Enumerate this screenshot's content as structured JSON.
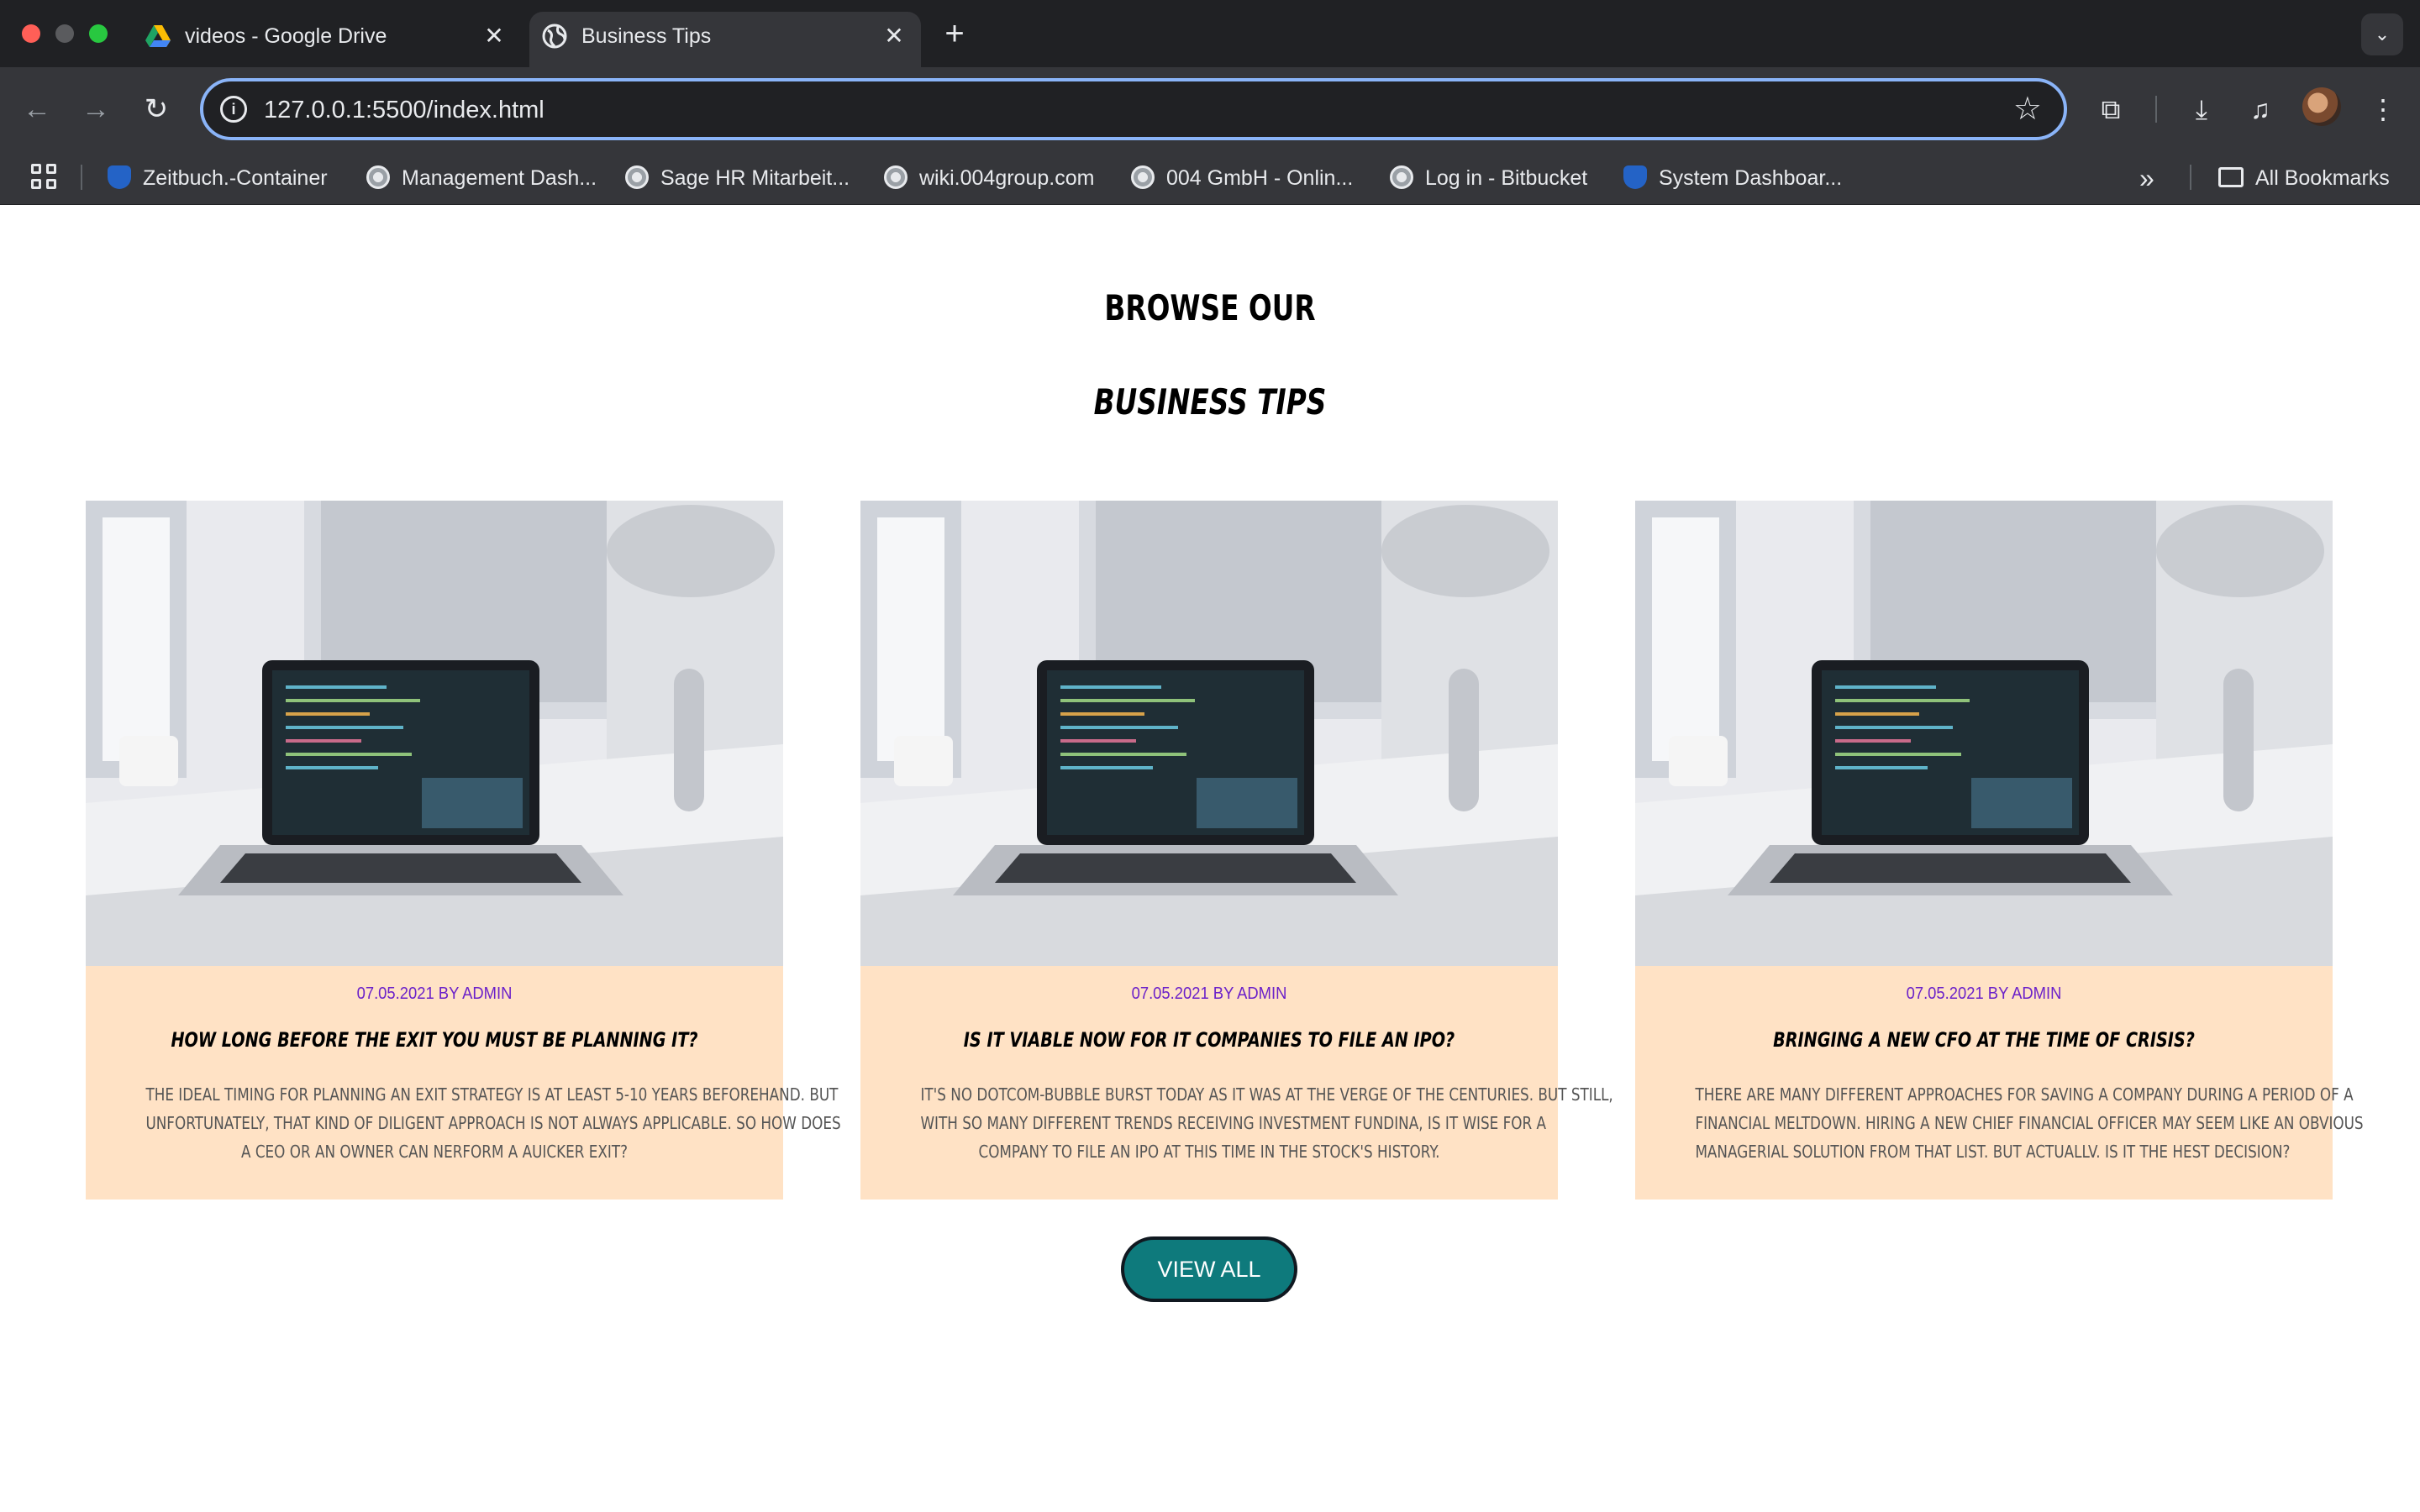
{
  "browser": {
    "tabs": [
      {
        "title": "videos - Google Drive",
        "active": false
      },
      {
        "title": "Business Tips",
        "active": true
      }
    ],
    "url": "127.0.0.1:5500/index.html",
    "bookmarks": [
      {
        "label": "Zeitbuch.-Container",
        "icon": "jira-icon"
      },
      {
        "label": "Management Dash...",
        "icon": "globe-icon"
      },
      {
        "label": "Sage HR Mitarbeit...",
        "icon": "globe-icon"
      },
      {
        "label": "wiki.004group.com",
        "icon": "globe-icon"
      },
      {
        "label": "004 GmbH - Onlin...",
        "icon": "globe-icon"
      },
      {
        "label": "Log in - Bitbucket",
        "icon": "globe-icon"
      },
      {
        "label": "System Dashboar...",
        "icon": "jira-icon"
      }
    ],
    "all_bookmarks_label": "All Bookmarks"
  },
  "page": {
    "heading_line1": "BROWSE OUR",
    "heading_line2": "BUSINESS TIPS",
    "cards": [
      {
        "meta": "07.05.2021 BY ADMIN",
        "title": "HOW LONG BEFORE THE EXIT YOU MUST BE PLANNING IT?",
        "excerpt": [
          "THE IDEAL TIMING FOR PLANNING AN EXIT STRATEGY IS AT LEAST 5-10 YEARS BEFOREHAND. BUT",
          "UNFORTUNATELY, THAT KIND OF DILIGENT APPROACH IS NOT ALWAYS APPLICABLE. SO HOW DOES",
          "A CEO OR AN OWNER CAN NERFORM A AUICKER EXIT?"
        ]
      },
      {
        "meta": "07.05.2021 BY ADMIN",
        "title": "IS IT VIABLE NOW FOR IT COMPANIES TO FILE AN IPO?",
        "excerpt": [
          "IT'S NO DOTCOM-BUBBLE BURST TODAY AS IT WAS AT THE VERGE OF THE CENTURIES. BUT STILL,",
          "WITH SO MANY DIFFERENT TRENDS RECEIVING INVESTMENT FUNDINA, IS IT WISE FOR A",
          "COMPANY TO FILE AN IPO AT THIS TIME IN THE STOCK'S HISTORY."
        ]
      },
      {
        "meta": "07.05.2021 BY ADMIN",
        "title": "BRINGING A NEW CFO AT THE TIME OF CRISIS?",
        "excerpt": [
          "THERE ARE MANY DIFFERENT APPROACHES FOR SAVING A COMPANY DURING A PERIOD OF A",
          "FINANCIAL MELTDOWN. HIRING A NEW CHIEF FINANCIAL OFFICER MAY SEEM LIKE AN OBVIOUS",
          "MANAGERIAL SOLUTION FROM THAT LIST. BUT ACTUALLV. IS IT THE HEST DECISION?"
        ]
      }
    ],
    "view_all_label": "VIEW ALL"
  },
  "colors": {
    "card_background": "#ffe2c5",
    "meta_purple": "#6b21c9",
    "button_teal": "#0e7a7c",
    "omnibox_focus": "#8ab4f8"
  }
}
